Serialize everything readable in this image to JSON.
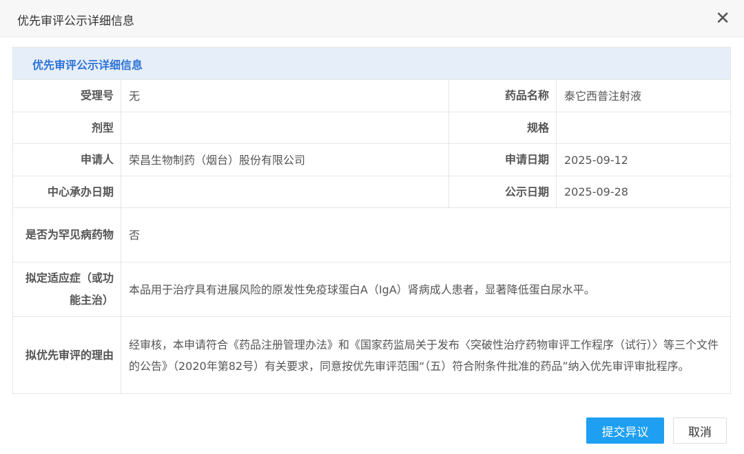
{
  "dialog": {
    "title": "优先审评公示详细信息",
    "close_icon": "close-icon"
  },
  "section_title": "优先审评公示详细信息",
  "fields": {
    "acceptance_no": {
      "label": "受理号",
      "value": "无"
    },
    "drug_name": {
      "label": "药品名称",
      "value": "泰它西普注射液"
    },
    "dosage_form": {
      "label": "剂型",
      "value": ""
    },
    "spec": {
      "label": "规格",
      "value": ""
    },
    "applicant": {
      "label": "申请人",
      "value": "荣昌生物制药（烟台）股份有限公司"
    },
    "apply_date": {
      "label": "申请日期",
      "value": "2025-09-12"
    },
    "center_date": {
      "label": "中心承办日期",
      "value": ""
    },
    "publish_date": {
      "label": "公示日期",
      "value": "2025-09-28"
    },
    "rare_disease": {
      "label": "是否为罕见病药物",
      "value": "否"
    },
    "indication": {
      "label": "拟定适应症（或功能主治）",
      "value": "本品用于治疗具有进展风险的原发性免疫球蛋白A（IgA）肾病成人患者，显著降低蛋白尿水平。"
    },
    "reason": {
      "label": "拟优先审评的理由",
      "value": "经审核，本申请符合《药品注册管理办法》和《国家药监局关于发布〈突破性治疗药物审评工作程序（试行）〉等三个文件的公告》（2020年第82号）有关要求，同意按优先审评范围“（五）符合附条件批准的药品”纳入优先审评审批程序。"
    }
  },
  "buttons": {
    "submit": "提交异议",
    "cancel": "取消"
  },
  "colors": {
    "accent": "#1e9ff2",
    "section_bg": "#e6eef9",
    "section_text": "#2d73d6"
  }
}
